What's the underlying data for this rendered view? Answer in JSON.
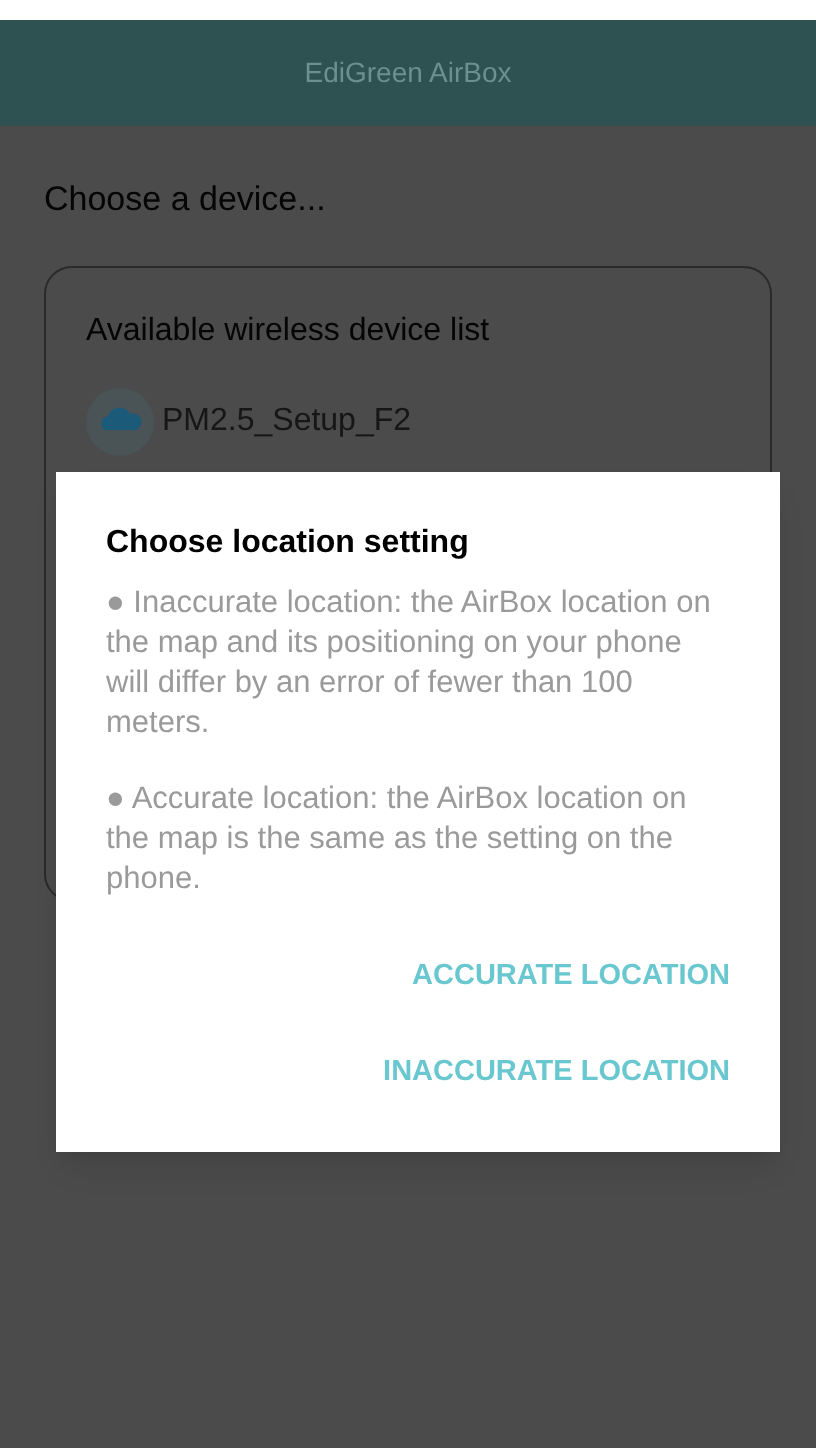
{
  "app_bar": {
    "title": "EdiGreen AirBox"
  },
  "prompt": "Choose a device...",
  "device_list": {
    "title": "Available wireless device list",
    "devices": [
      {
        "name": "PM2.5_Setup_F2"
      }
    ]
  },
  "dialog": {
    "title": "Choose location setting",
    "paragraphs": [
      "● Inaccurate location: the AirBox location on the map and its positioning on your phone will differ by an error of fewer than 100 meters.",
      "● Accurate location: the AirBox location on the map is the same as the setting on the phone."
    ],
    "buttons": [
      "ACCURATE LOCATION",
      "INACCURATE LOCATION"
    ]
  }
}
